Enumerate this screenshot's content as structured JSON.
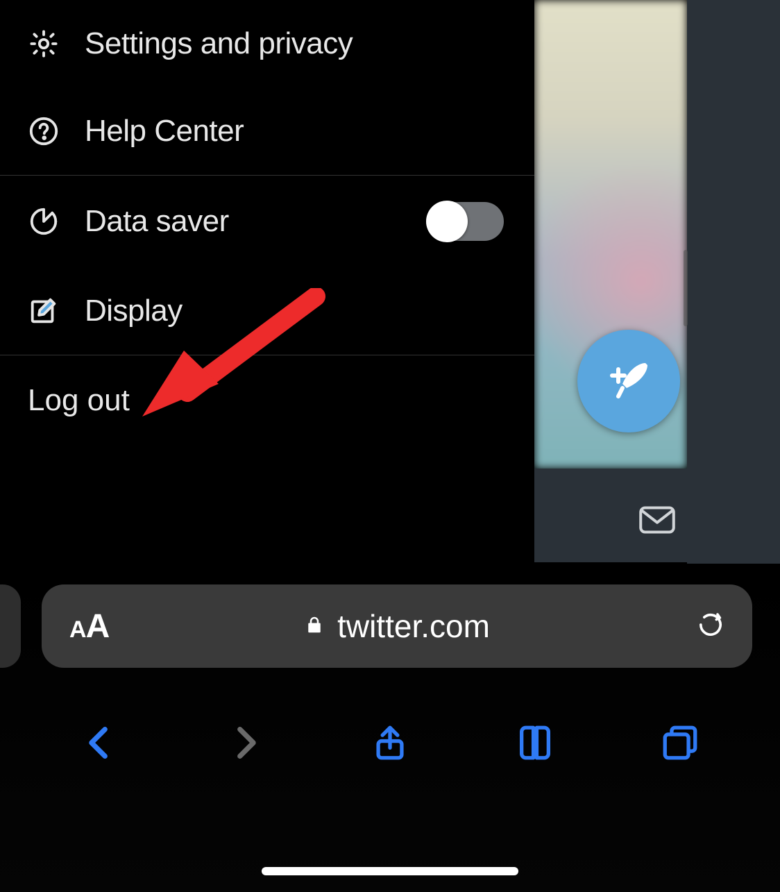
{
  "menu": {
    "settings_label": "Settings and privacy",
    "help_label": "Help Center",
    "data_saver_label": "Data saver",
    "data_saver_on": false,
    "display_label": "Display",
    "logout_label": "Log out"
  },
  "icons": {
    "settings": "gear-icon",
    "help": "help-circle-icon",
    "data_saver": "pie-chart-icon",
    "display": "edit-square-icon",
    "compose": "compose-feather-icon",
    "mail": "mail-icon"
  },
  "safari": {
    "domain": "twitter.com",
    "aa_small": "A",
    "aa_big": "A"
  },
  "colors": {
    "accent_blue": "#2f7af5",
    "fab_blue": "#5aa6de",
    "arrow_red": "#ed2b2b"
  }
}
